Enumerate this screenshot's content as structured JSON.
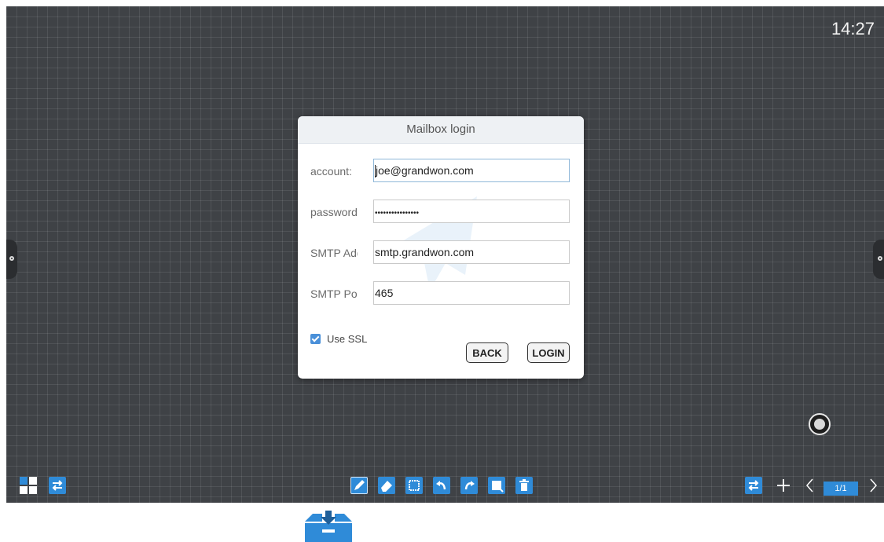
{
  "status_bar": {
    "time": "14:27"
  },
  "dialog": {
    "title": "Mailbox login",
    "fields": [
      {
        "label": "account:",
        "value": "joe@grandwon.com"
      },
      {
        "label": "password:",
        "value": "••••••••••••••••"
      },
      {
        "label": "SMTP Address:",
        "value": "smtp.grandwon.com"
      },
      {
        "label": "SMTP Port:",
        "value": "465"
      }
    ],
    "use_ssl_label": "Use SSL",
    "back_label": "BACK",
    "login_label": "LOGIN"
  },
  "pager": {
    "label": "1/1"
  },
  "icons": {
    "left_toolbar": [
      "grid-icon",
      "switch-icon"
    ],
    "center_toolbar": [
      "pen-icon",
      "eraser-icon",
      "select-icon",
      "undo-icon",
      "redo-icon",
      "roam-icon",
      "delete-icon"
    ],
    "right_toolbar": [
      "switch-icon",
      "add-page-icon",
      "prev-page-icon",
      "next-page-icon"
    ],
    "accent_color": "#2f8bd8"
  }
}
